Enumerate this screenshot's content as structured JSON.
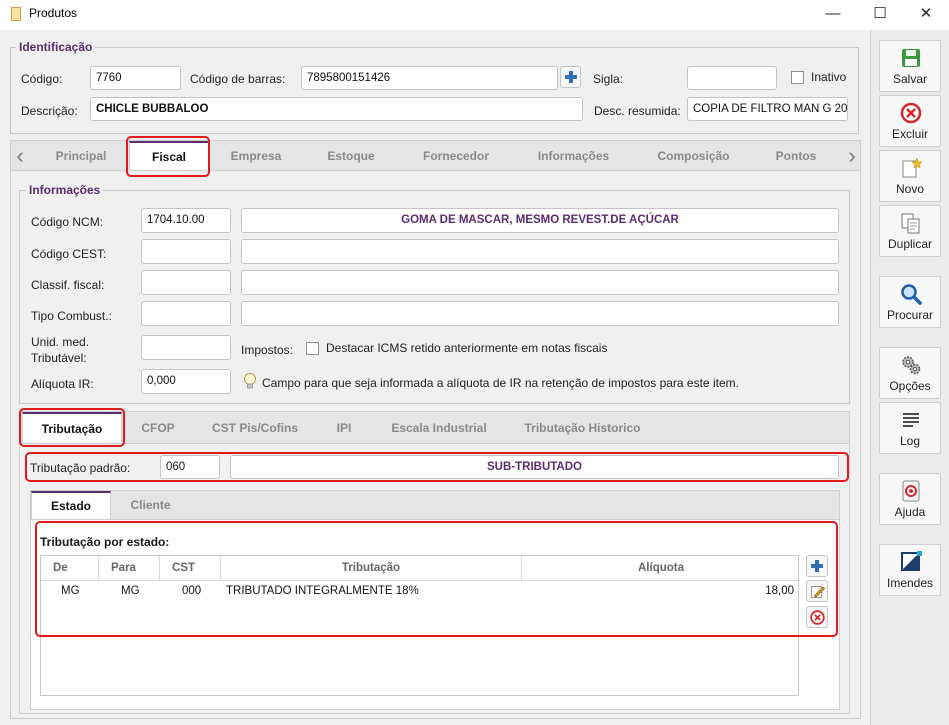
{
  "window": {
    "title": "Produtos",
    "minimize_glyph": "—",
    "maximize_glyph": "☐",
    "close_glyph": "✕"
  },
  "identificacao": {
    "legend": "Identificação",
    "codigo_label": "Código:",
    "codigo_value": "7760",
    "codigo_barras_label": "Código de barras:",
    "codigo_barras_value": "7895800151426",
    "sigla_label": "Sigla:",
    "sigla_value": "",
    "inativo_label": "Inativo",
    "descricao_label": "Descrição:",
    "descricao_value": "CHICLE BUBBALOO",
    "desc_resumida_label": "Desc. resumida:",
    "desc_resumida_value": "COPIA DE FILTRO MAN G 20"
  },
  "main_tabs": {
    "left_arrow": "‹",
    "right_arrow": "›",
    "items": [
      "Principal",
      "Fiscal",
      "Empresa",
      "Estoque",
      "Fornecedor",
      "Informações",
      "Composição",
      "Pontos"
    ],
    "active": "Fiscal"
  },
  "informacoes": {
    "legend": "Informações",
    "ncm_label": "Código NCM:",
    "ncm_value": "1704.10.00",
    "ncm_desc": "GOMA DE MASCAR, MESMO REVEST.DE AÇÚCAR",
    "cest_label": "Código CEST:",
    "classif_label": "Classif. fiscal:",
    "combust_label": "Tipo Combust.:",
    "unid_label_1": "Unid. med.",
    "unid_label_2": "Tributável:",
    "impostos_label": "Impostos:",
    "destacar_label": "Destacar ICMS retido anteriormente em notas fiscais",
    "aliquota_label": "Alíquota IR:",
    "aliquota_value": "0,000",
    "aliquota_hint": "Campo para que seja informada a alíquota de IR na retenção de impostos para este item."
  },
  "sub_tabs": {
    "items": [
      "Tributação",
      "CFOP",
      "CST Pis/Cofins",
      "IPI",
      "Escala Industrial",
      "Tributação Historico"
    ],
    "active": "Tributação"
  },
  "tributacao": {
    "padrao_label": "Tributação padrão:",
    "padrao_value": "060",
    "padrao_desc": "SUB-TRIBUTADO"
  },
  "estado_tabs": {
    "items": [
      "Estado",
      "Cliente"
    ],
    "active": "Estado"
  },
  "tributacao_estado": {
    "title": "Tributação por estado:",
    "columns": [
      "De",
      "Para",
      "CST",
      "Tributação",
      "Alíquota"
    ],
    "rows": [
      {
        "de": "MG",
        "para": "MG",
        "cst": "000",
        "tributacao": "TRIBUTADO INTEGRALMENTE 18%",
        "aliquota": "18,00"
      }
    ]
  },
  "toolbar": {
    "salvar": "Salvar",
    "excluir": "Excluir",
    "novo": "Novo",
    "duplicar": "Duplicar",
    "procurar": "Procurar",
    "opcoes": "Opções",
    "log": "Log",
    "ajuda": "Ajuda",
    "imendes": "Imendes"
  },
  "colors": {
    "accent": "#5b2c6f",
    "highlight": "#e11a1a",
    "add_icon": "#2f6db5",
    "delete_icon": "#d9262b",
    "save_icon": "#3a9a3a"
  }
}
